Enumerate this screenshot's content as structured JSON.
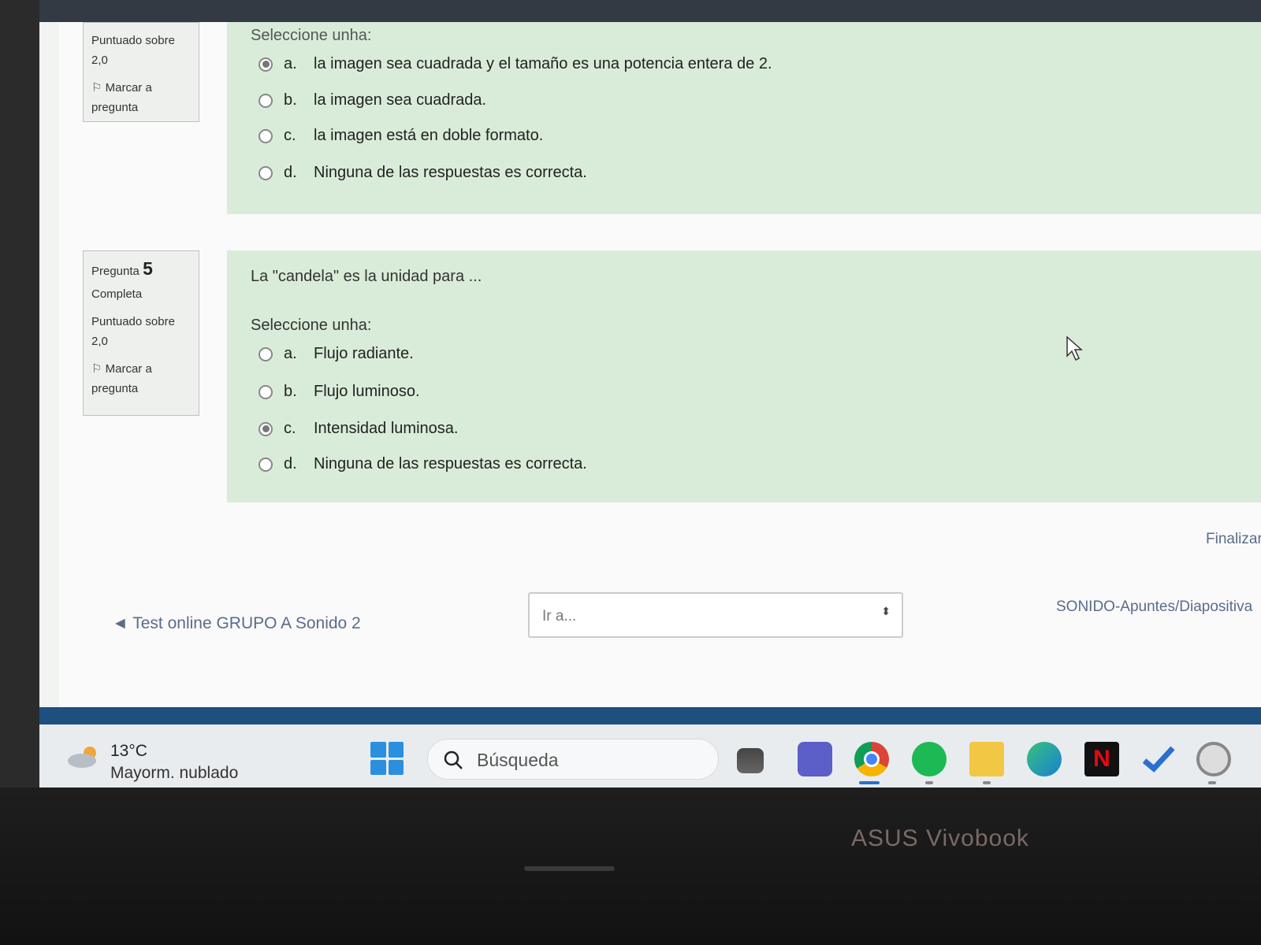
{
  "question4": {
    "score_label": "Puntuado sobre",
    "score_value": "2,0",
    "flag_label": "Marcar a",
    "flag_label_2": "pregunta",
    "prompt": "Seleccione unha:",
    "options": [
      {
        "letter": "a.",
        "text": "la imagen sea cuadrada y el tamaño es una potencia entera de 2.",
        "selected": true
      },
      {
        "letter": "b.",
        "text": "la imagen sea cuadrada.",
        "selected": false
      },
      {
        "letter": "c.",
        "text": "la imagen está en doble formato.",
        "selected": false
      },
      {
        "letter": "d.",
        "text": "Ninguna de las respuestas es correcta.",
        "selected": false
      }
    ]
  },
  "question5": {
    "label": "Pregunta",
    "number": "5",
    "status": "Completa",
    "score_label": "Puntuado sobre",
    "score_value": "2,0",
    "flag_label": "Marcar a",
    "flag_label_2": "pregunta",
    "question_text": "La \"candela\" es la unidad para ...",
    "prompt": "Seleccione unha:",
    "options": [
      {
        "letter": "a.",
        "text": "Flujo radiante.",
        "selected": false
      },
      {
        "letter": "b.",
        "text": "Flujo luminoso.",
        "selected": false
      },
      {
        "letter": "c.",
        "text": "Intensidad luminosa.",
        "selected": true
      },
      {
        "letter": "d.",
        "text": "Ninguna de las respuestas es correcta.",
        "selected": false
      }
    ]
  },
  "navigation": {
    "finish": "Finalizar",
    "previous": "◄ Test online GRUPO A Sonido 2",
    "jump_placeholder": "Ir a...",
    "jump_arrows": "⬍",
    "next": "SONIDO-Apuntes/Diapositiva"
  },
  "taskbar": {
    "temperature": "13°C",
    "weather": "Mayorm. nublado",
    "search_placeholder": "Búsqueda",
    "apps": [
      "file-manager-icon",
      "teams-icon",
      "chrome-icon",
      "spotify-icon",
      "folder-icon",
      "edge-icon",
      "netflix-icon",
      "todo-icon",
      "clock-icon"
    ]
  },
  "device": {
    "brand": "ASUS Vivobook"
  },
  "colors": {
    "question_bg": "#d9ecd9",
    "link": "#5a6c8c",
    "taskbar": "#e9ecef",
    "accent_bar": "#1d4f7f"
  }
}
